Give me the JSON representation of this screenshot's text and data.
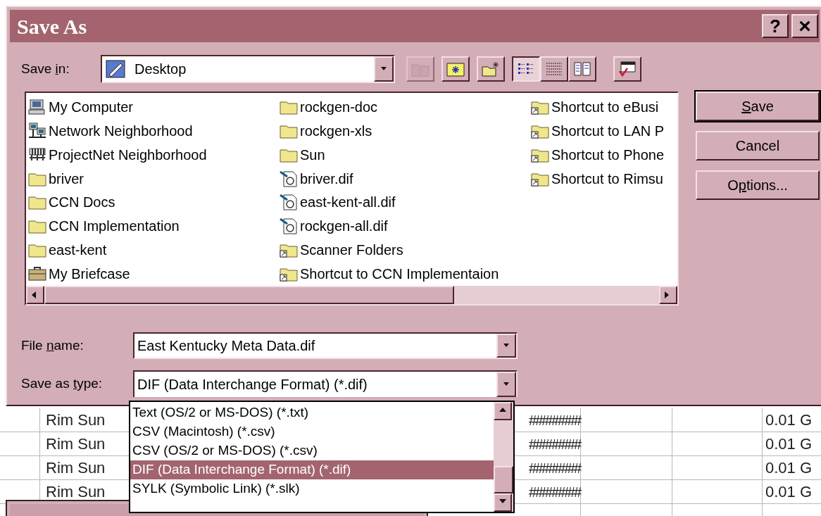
{
  "window": {
    "title": "Save As",
    "help_button": "?",
    "close_button": "×"
  },
  "save_in": {
    "label_parts": [
      {
        "text": "Save ",
        "underline": false
      },
      {
        "text": "i",
        "underline": true
      },
      {
        "text": "n:",
        "underline": false
      }
    ],
    "value": "Desktop"
  },
  "toolbar": [
    {
      "kind": "up-folder",
      "disabled": true,
      "selected": false
    },
    {
      "kind": "favorites-folder",
      "disabled": false,
      "selected": false
    },
    {
      "kind": "new-folder",
      "disabled": false,
      "selected": false
    },
    {
      "kind": "list-view",
      "disabled": false,
      "selected": true
    },
    {
      "kind": "details-view",
      "disabled": false,
      "selected": false
    },
    {
      "kind": "properties-view",
      "disabled": false,
      "selected": false
    },
    {
      "kind": "commands",
      "disabled": false,
      "selected": false
    }
  ],
  "files": [
    [
      {
        "kind": "computer",
        "name": "My Computer"
      },
      {
        "kind": "network",
        "name": "Network Neighborhood"
      },
      {
        "kind": "network-grid",
        "name": "ProjectNet Neighborhood"
      },
      {
        "kind": "folder",
        "name": "briver"
      },
      {
        "kind": "folder",
        "name": "CCN Docs"
      },
      {
        "kind": "folder",
        "name": "CCN Implementation"
      },
      {
        "kind": "folder",
        "name": "east-kent"
      },
      {
        "kind": "briefcase",
        "name": "My Briefcase"
      }
    ],
    [
      {
        "kind": "folder",
        "name": "rockgen-doc"
      },
      {
        "kind": "folder",
        "name": "rockgen-xls"
      },
      {
        "kind": "folder",
        "name": "Sun"
      },
      {
        "kind": "document",
        "name": "briver.dif"
      },
      {
        "kind": "document",
        "name": "east-kent-all.dif"
      },
      {
        "kind": "document",
        "name": "rockgen-all.dif"
      },
      {
        "kind": "shortcut",
        "name": "Scanner Folders"
      },
      {
        "kind": "shortcut",
        "name": "Shortcut to CCN Implementaion"
      }
    ],
    [
      {
        "kind": "shortcut",
        "name": "Shortcut to eBusi"
      },
      {
        "kind": "shortcut",
        "name": "Shortcut to LAN P"
      },
      {
        "kind": "shortcut",
        "name": "Shortcut to Phone"
      },
      {
        "kind": "shortcut",
        "name": "Shortcut to Rimsu"
      }
    ]
  ],
  "buttons": [
    {
      "label_parts": [
        {
          "text": "S",
          "underline": true
        },
        {
          "text": "ave",
          "underline": false
        }
      ],
      "default": true
    },
    {
      "label_parts": [
        {
          "text": "Cancel",
          "underline": false
        }
      ],
      "default": false
    },
    {
      "label_parts": [
        {
          "text": "O",
          "underline": false
        },
        {
          "text": "p",
          "underline": true
        },
        {
          "text": "tions...",
          "underline": false
        }
      ],
      "default": false
    }
  ],
  "file_name": {
    "label_parts": [
      {
        "text": "File ",
        "underline": false
      },
      {
        "text": "n",
        "underline": true
      },
      {
        "text": "ame:",
        "underline": false
      }
    ],
    "value": "East Kentucky Meta Data.dif"
  },
  "save_as_type": {
    "label_parts": [
      {
        "text": "Save as ",
        "underline": false
      },
      {
        "text": "t",
        "underline": true
      },
      {
        "text": "ype:",
        "underline": false
      }
    ],
    "value": "DIF (Data Interchange Format) (*.dif)",
    "options": [
      {
        "label": "Text (OS/2 or MS-DOS) (*.txt)",
        "selected": false
      },
      {
        "label": "CSV (Macintosh) (*.csv)",
        "selected": false
      },
      {
        "label": "CSV (OS/2 or MS-DOS) (*.csv)",
        "selected": false
      },
      {
        "label": "DIF (Data Interchange Format) (*.dif)",
        "selected": true
      },
      {
        "label": "SYLK (Symbolic Link) (*.slk)",
        "selected": false
      }
    ]
  },
  "spreadsheet": {
    "rows": [
      {
        "name": "Rim Sun",
        "value": "########",
        "amount": "0.01 G"
      },
      {
        "name": "Rim Sun",
        "value": "########",
        "amount": "0.01 G"
      },
      {
        "name": "Rim Sun",
        "value": "########",
        "amount": "0.01 G"
      },
      {
        "name": "Rim Sun",
        "value": "########",
        "amount": "0.01 G"
      }
    ]
  }
}
